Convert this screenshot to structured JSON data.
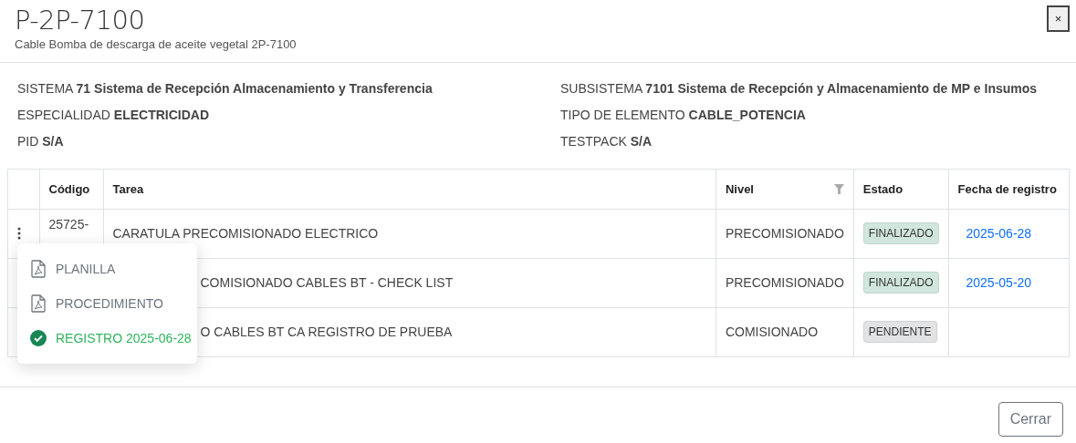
{
  "title": "P-2P-7100",
  "subtitle": "Cable Bomba de descarga de aceite vegetal 2P-7100",
  "close_button": "×",
  "info": [
    {
      "label": "SISTEMA",
      "value": "71 Sistema de Recepción Almacenamiento y Transferencia"
    },
    {
      "label": "SUBSISTEMA",
      "value": "7101 Sistema de Recepción y Almacenamiento de MP e Insumos"
    },
    {
      "label": "ESPECIALIDAD",
      "value": "ELECTRICIDAD"
    },
    {
      "label": "TIPO DE ELEMENTO",
      "value": "CABLE_POTENCIA"
    },
    {
      "label": "PID",
      "value": "S/A"
    },
    {
      "label": "TESTPACK",
      "value": "S/A"
    }
  ],
  "table": {
    "columns": [
      "Código",
      "Tarea",
      "Nivel",
      "Estado",
      "Fecha de registro"
    ],
    "rows": [
      {
        "code": "25725-",
        "task": "CARATULA PRECOMISIONADO ELECTRICO",
        "level": "PRECOMISIONADO",
        "status": "FINALIZADO",
        "color": "#d1e7dd",
        "date": "2025-06-28",
        "covered": false,
        "menu": [
          {
            "label": "PLANILLA",
            "kind": "pdf"
          },
          {
            "label": "PROCEDIMIENTO",
            "kind": "pdf"
          },
          {
            "label": "REGISTRO 2025-06-28",
            "kind": "done"
          }
        ]
      },
      {
        "task": "COMISIONADO CABLES BT - CHECK LIST",
        "level": "PRECOMISIONADO",
        "status": "FINALIZADO",
        "color": "#d1e7dd",
        "date": "2025-05-20",
        "covered": true
      },
      {
        "task": "O CABLES BT CA REGISTRO DE PRUEBA",
        "level": "COMISIONADO",
        "status": "PENDIENTE",
        "color": "#e2e3e5",
        "covered": true
      }
    ]
  },
  "footer_button": "Cerrar"
}
